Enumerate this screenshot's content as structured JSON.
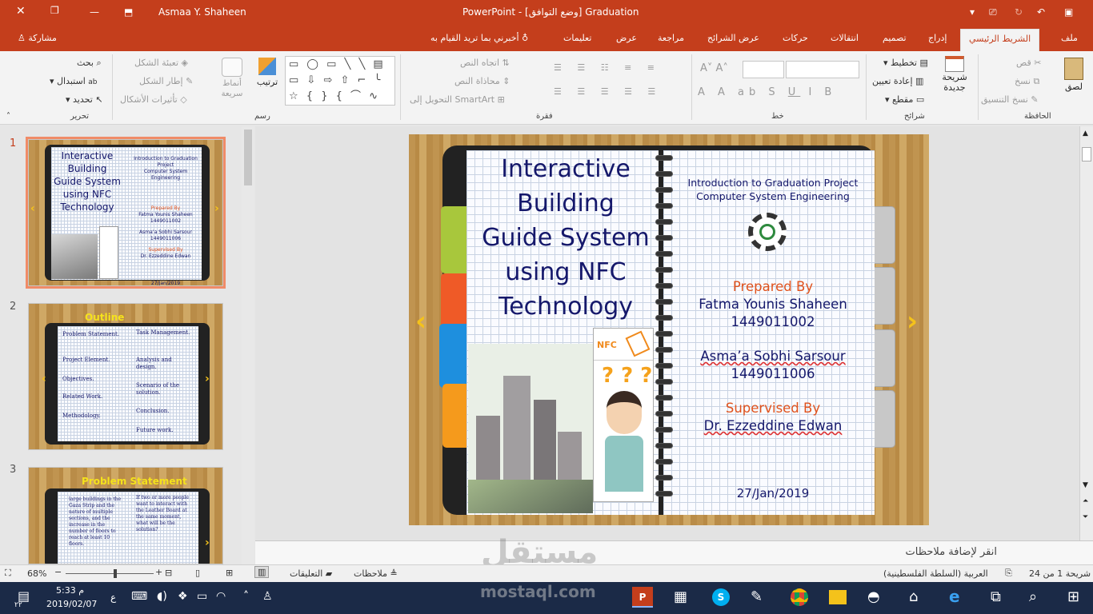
{
  "titlebar": {
    "user": "Asmaa Y. Shaheen",
    "app_title": "PowerPoint - [وضع التوافق] Graduation"
  },
  "tabs": {
    "file": "ملف",
    "home": "الشريط الرئيسي",
    "insert": "إدراج",
    "design": "تصميم",
    "transitions": "انتقالات",
    "animations": "حركات",
    "slideshow": "عرض الشرائح",
    "review": "مراجعة",
    "view": "عرض",
    "comments": "تعليمات",
    "tell_me": "أخبرني بما تريد القيام به",
    "share": "مشاركة"
  },
  "ribbon": {
    "paste": "لصق",
    "cut": "قص",
    "copy": "نسخ",
    "format_painter": "نسخ التنسيق",
    "clipboard": "الحافظة",
    "new_slide": "شريحة جديدة",
    "layout": "تخطيط",
    "reset": "إعادة تعيين",
    "section": "مقطع",
    "slides": "شرائح",
    "font": "خط",
    "text_direction": "اتجاه النص",
    "align_text": "محاذاة النص",
    "smartart": "التحويل إلى SmartArt",
    "paragraph": "فقرة",
    "arrange": "ترتيب",
    "quick_styles": "أنماط سريعة",
    "shape_fill": "تعبئة الشكل",
    "shape_outline": "إطار الشكل",
    "shape_effects": "تأثيرات الأشكال",
    "drawing": "رسم",
    "find": "بحث",
    "replace": "استبدال",
    "select": "تحديد",
    "editing": "تحرير"
  },
  "slide": {
    "title": "Interactive Building Guide System using NFC Technology",
    "title_lines": [
      "Interactive",
      "Building",
      "Guide System",
      "using NFC",
      "Technology"
    ],
    "intro_line1": "Introduction to Graduation Project",
    "intro_line2": "Computer System Engineering",
    "prepared_by": "Prepared By",
    "student1": "Fatma Younis Shaheen",
    "student1_id": "1449011002",
    "student2": "Asma’a Sobhi Sarsour",
    "student2_id": "1449011006",
    "supervised_by": "Supervised By",
    "supervisor": "Dr. Ezzeddine Edwan",
    "date": "27/Jan/2019",
    "nfc_label": "NFC"
  },
  "thumbnails": [
    {
      "num": "1"
    },
    {
      "num": "2",
      "heading": "Outline",
      "left": [
        "Problem Statement.",
        "Project Element.",
        "Objectives.",
        "Related Work.",
        "Methodology."
      ],
      "right": [
        "Task Management.",
        "Analysis and design.",
        "Scenario of the solution.",
        "Conclusion.",
        "Future work."
      ]
    },
    {
      "num": "3",
      "heading": "Problem Statement",
      "left_text": "large buildings in the Gaza Strip and the nature of multiple sections, and the increase in the number of floors to reach at least 10 floors.",
      "right_text": "If two or more people want to interact with the Leather Board at the same moment, what will be the solution?"
    }
  ],
  "notes_placeholder": "انقر لإضافة ملاحظات",
  "status": {
    "slide_count": "شريحة 1 من 24",
    "language": "العربية (السلطة الفلسطينية)",
    "notes": "ملاحظات",
    "comments": "التعليقات",
    "zoom": "68%"
  },
  "taskbar": {
    "time": "5:33 م",
    "date": "2019/02/07",
    "lang": "ع",
    "notif_count": "٢٢"
  },
  "watermark": {
    "brand": "مستقل",
    "url": "mostaql.com"
  }
}
